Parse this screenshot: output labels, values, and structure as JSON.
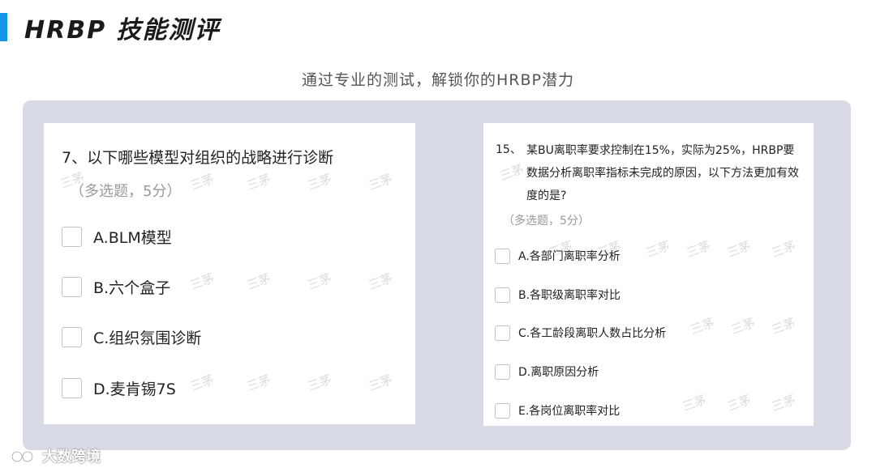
{
  "header": {
    "title": "HRBP  技能测评",
    "accent_color": "#1296e8"
  },
  "subtitle": "通过专业的测试，解锁你的HRBP潜力",
  "left_question": {
    "title": "7、以下哪些模型对组织的战略进行诊断",
    "note": "（多选题，5分）",
    "options": [
      "A.BLM模型",
      "B.六个盒子",
      "C.组织氛围诊断",
      "D.麦肯锡7S"
    ]
  },
  "right_question": {
    "number": "15、",
    "title": "某BU离职率要求控制在15%，实际为25%，HRBP要数据分析离职率指标未完成的原因，以下方法更加有效度的是?",
    "note": "（多选题，5分）",
    "options": [
      "A.各部门离职率分析",
      "B.各职级离职率对比",
      "C.各工龄段离职人数占比分析",
      "D.离职原因分析",
      "E.各岗位离职率对比"
    ]
  },
  "watermark": "三茅",
  "footer": {
    "brand": "大数跨境",
    "logo_icon": "brand-logo-icon"
  }
}
